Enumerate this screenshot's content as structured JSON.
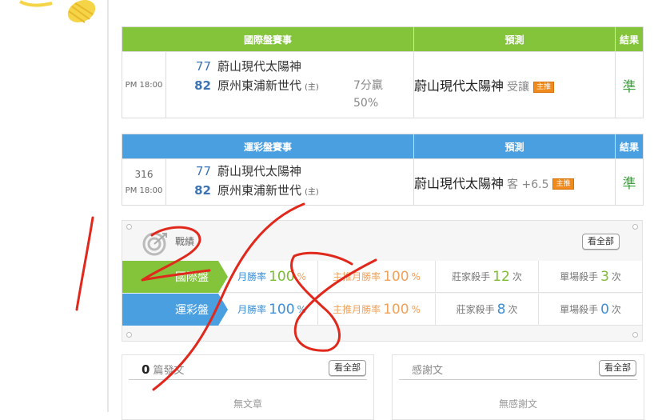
{
  "intl_card": {
    "header": {
      "match": "國際盤賽事",
      "predict": "預測",
      "result": "結果"
    },
    "time": "PM 18:00",
    "team1": {
      "score": "77",
      "name": "蔚山現代太陽神"
    },
    "team2": {
      "score": "82",
      "name": "原州東浦新世代",
      "tag": "(主)"
    },
    "handicap": "7分贏",
    "handicap_pct": "50%",
    "prediction": {
      "team": "蔚山現代太陽神",
      "sub": "受讓",
      "badge": "主推"
    },
    "result": "準"
  },
  "lottery_card": {
    "header": {
      "match": "運彩盤賽事",
      "predict": "預測",
      "result": "結果"
    },
    "game_no": "316",
    "time": "PM 18:00",
    "team1": {
      "score": "77",
      "name": "蔚山現代太陽神"
    },
    "team2": {
      "score": "82",
      "name": "原州東浦新世代",
      "tag": "(主)"
    },
    "prediction": {
      "team": "蔚山現代太陽神",
      "sub": "客 +6.5",
      "badge": "主推"
    },
    "result": "準"
  },
  "record": {
    "title": "戰績",
    "view_all": "看全部",
    "rows": [
      {
        "label": "國際盤",
        "month_label": "月勝率",
        "month_value": "100",
        "month_unit": "%",
        "main_label": "主推月勝率",
        "main_value": "100",
        "main_unit": "%",
        "house_label": "莊家殺手",
        "house_value": "12",
        "house_unit": "次",
        "single_label": "單場殺手",
        "single_value": "3",
        "single_unit": "次"
      },
      {
        "label": "運彩盤",
        "month_label": "月勝率",
        "month_value": "100",
        "month_unit": "%",
        "main_label": "主推月勝率",
        "main_value": "100",
        "main_unit": "%",
        "house_label": "莊家殺手",
        "house_value": "8",
        "house_unit": "次",
        "single_label": "單場殺手",
        "single_value": "0",
        "single_unit": "次"
      }
    ]
  },
  "posts": {
    "count": "0",
    "title": "篇發文",
    "view_all": "看全部",
    "empty": "無文章"
  },
  "thanks": {
    "title": "感謝文",
    "view_all": "看全部",
    "empty": "無感謝文"
  },
  "colors": {
    "green": "#83c43a",
    "blue": "#4a9fe0",
    "orange": "#f08a1c",
    "scribble": "#e0281c"
  }
}
